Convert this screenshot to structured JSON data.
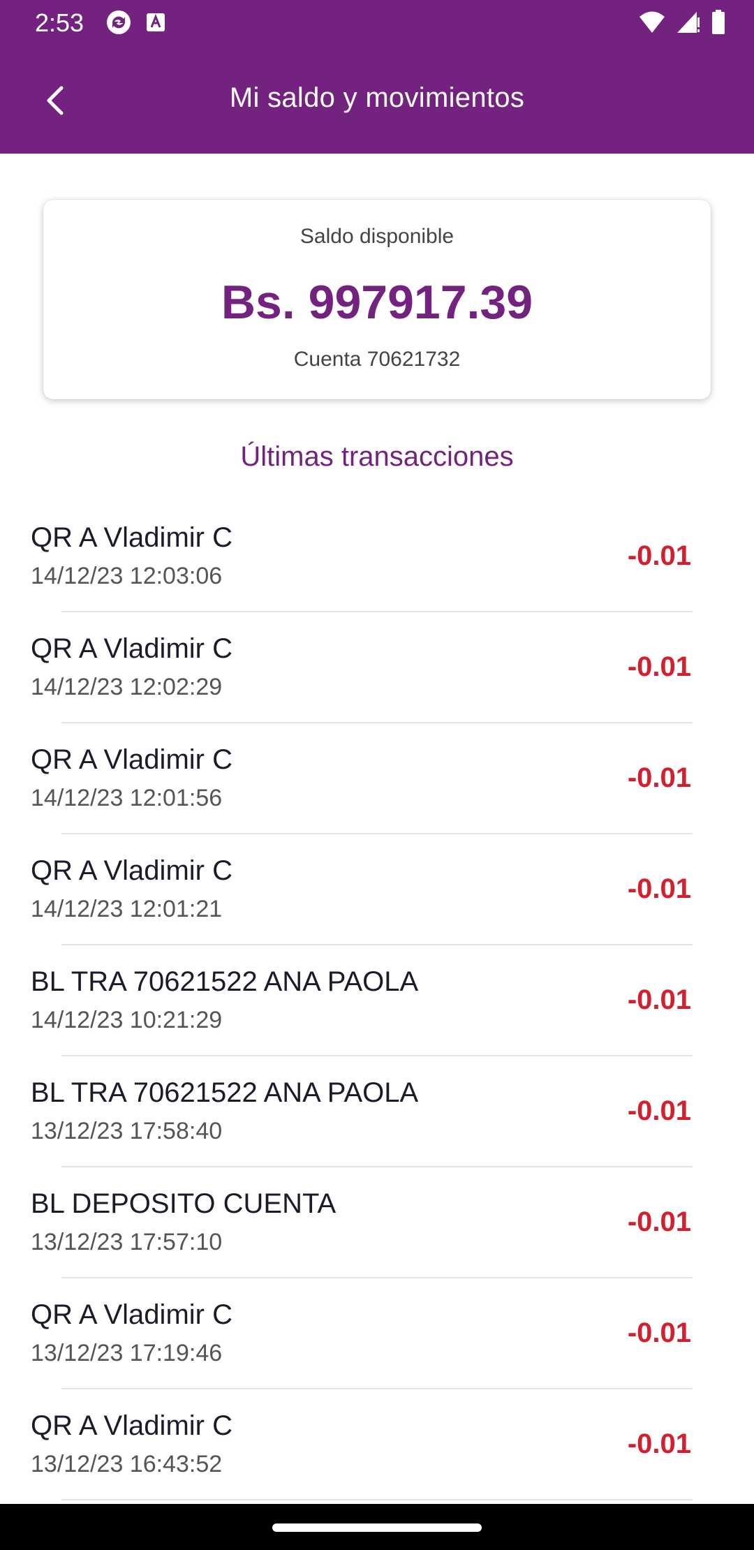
{
  "status_bar": {
    "time": "2:53",
    "left_icons": [
      "sync-app-icon",
      "a-box-icon"
    ],
    "right_icons": [
      "wifi-icon",
      "cell-signal-icon",
      "battery-icon"
    ]
  },
  "header": {
    "title": "Mi saldo y movimientos",
    "back_icon": "chevron-left-icon"
  },
  "balance": {
    "label": "Saldo disponible",
    "amount": "Bs. 997917.39",
    "account": "Cuenta 70621732"
  },
  "transactions_title": "Últimas transacciones",
  "transactions": [
    {
      "desc": "QR A Vladimir C",
      "date": "14/12/23 12:03:06",
      "amount": "-0.01"
    },
    {
      "desc": "QR A Vladimir C",
      "date": "14/12/23 12:02:29",
      "amount": "-0.01"
    },
    {
      "desc": "QR A Vladimir C",
      "date": "14/12/23 12:01:56",
      "amount": "-0.01"
    },
    {
      "desc": "QR A Vladimir C",
      "date": "14/12/23 12:01:21",
      "amount": "-0.01"
    },
    {
      "desc": "BL TRA 70621522 ANA PAOLA",
      "date": "14/12/23 10:21:29",
      "amount": "-0.01"
    },
    {
      "desc": "BL TRA 70621522 ANA PAOLA",
      "date": "13/12/23 17:58:40",
      "amount": "-0.01"
    },
    {
      "desc": "BL DEPOSITO CUENTA",
      "date": "13/12/23 17:57:10",
      "amount": "-0.01"
    },
    {
      "desc": "QR A Vladimir C",
      "date": "13/12/23 17:19:46",
      "amount": "-0.01"
    },
    {
      "desc": "QR A Vladimir C",
      "date": "13/12/23 16:43:52",
      "amount": "-0.01"
    }
  ],
  "colors": {
    "brand": "#74227f",
    "negative": "#d3202f"
  }
}
